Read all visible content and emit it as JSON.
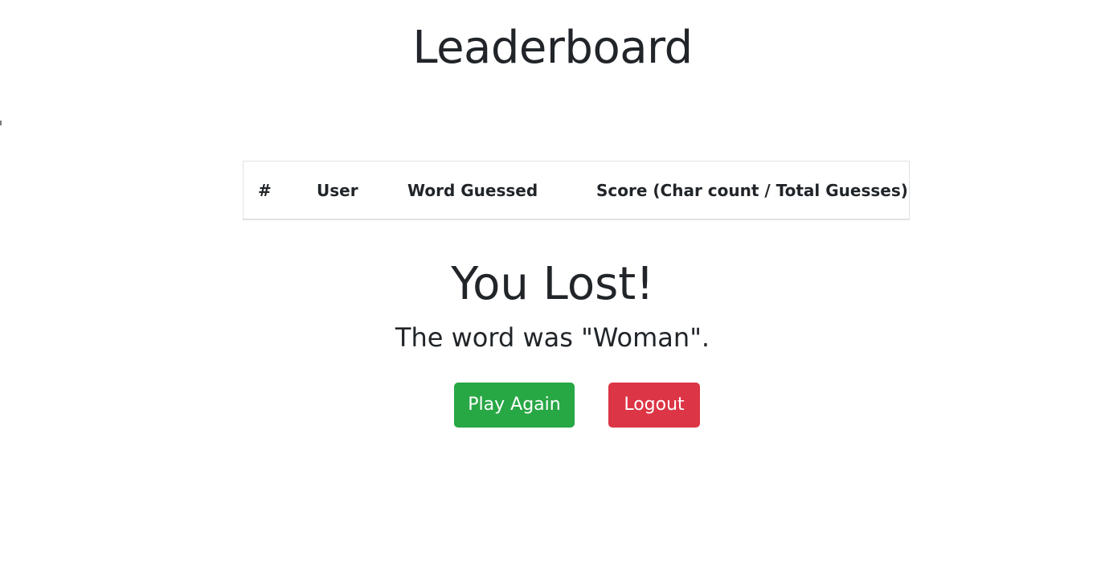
{
  "page": {
    "title": "Leaderboard"
  },
  "leaderboard": {
    "columns": [
      "#",
      "User",
      "Word Guessed",
      "Score (Char count / Total Guesses)"
    ],
    "rows": []
  },
  "result": {
    "heading": "You Lost!",
    "message": "The word was \"Woman\"."
  },
  "actions": {
    "play_again_label": "Play Again",
    "logout_label": "Logout"
  },
  "colors": {
    "text": "#212529",
    "success": "#28a745",
    "danger": "#dc3545",
    "table_border": "#dee2e6",
    "background": "#ffffff"
  }
}
